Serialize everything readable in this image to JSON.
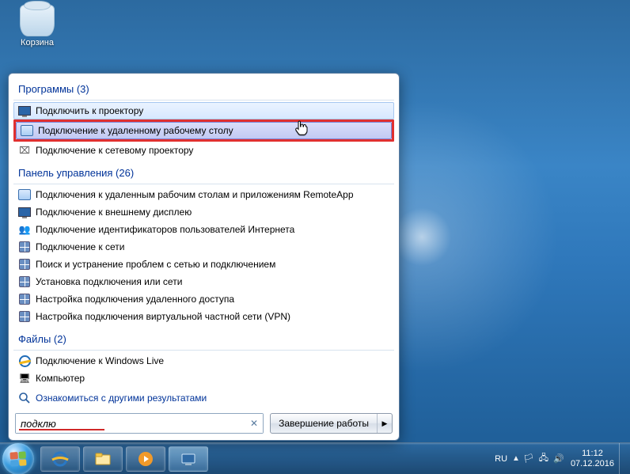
{
  "desktop": {
    "recycle_bin_label": "Корзина"
  },
  "start_menu": {
    "groups": [
      {
        "title": "Программы (3)",
        "items": [
          {
            "label": "Подключить к проектору",
            "icon": "projector-icon",
            "state": "hover"
          },
          {
            "label": "Подключение к удаленному рабочему столу",
            "icon": "rdp-icon",
            "state": "selected",
            "highlighted": true
          },
          {
            "label": "Подключение к сетевому проектору",
            "icon": "network-projector-icon",
            "state": ""
          }
        ]
      },
      {
        "title": "Панель управления (26)",
        "items": [
          {
            "label": "Подключения к удаленным рабочим столам и приложениям RemoteApp",
            "icon": "remoteapp-icon"
          },
          {
            "label": "Подключение к внешнему дисплею",
            "icon": "external-display-icon"
          },
          {
            "label": "Подключение идентификаторов пользователей Интернета",
            "icon": "users-icon"
          },
          {
            "label": "Подключение к сети",
            "icon": "network-icon"
          },
          {
            "label": "Поиск и устранение проблем с сетью и подключением",
            "icon": "network-troubleshoot-icon"
          },
          {
            "label": "Установка подключения или сети",
            "icon": "setup-network-icon"
          },
          {
            "label": "Настройка подключения удаленного доступа",
            "icon": "dialup-icon"
          },
          {
            "label": "Настройка подключения виртуальной частной сети (VPN)",
            "icon": "vpn-icon"
          }
        ]
      },
      {
        "title": "Файлы (2)",
        "items": [
          {
            "label": "Подключение к Windows Live",
            "icon": "ie-icon"
          },
          {
            "label": "Компьютер",
            "icon": "computer-icon"
          }
        ]
      }
    ],
    "see_more": "Ознакомиться с другими результатами",
    "search_value": "подклю",
    "shutdown_label": "Завершение работы"
  },
  "taskbar": {
    "lang": "RU",
    "time": "11:12",
    "date": "07.12.2016"
  }
}
